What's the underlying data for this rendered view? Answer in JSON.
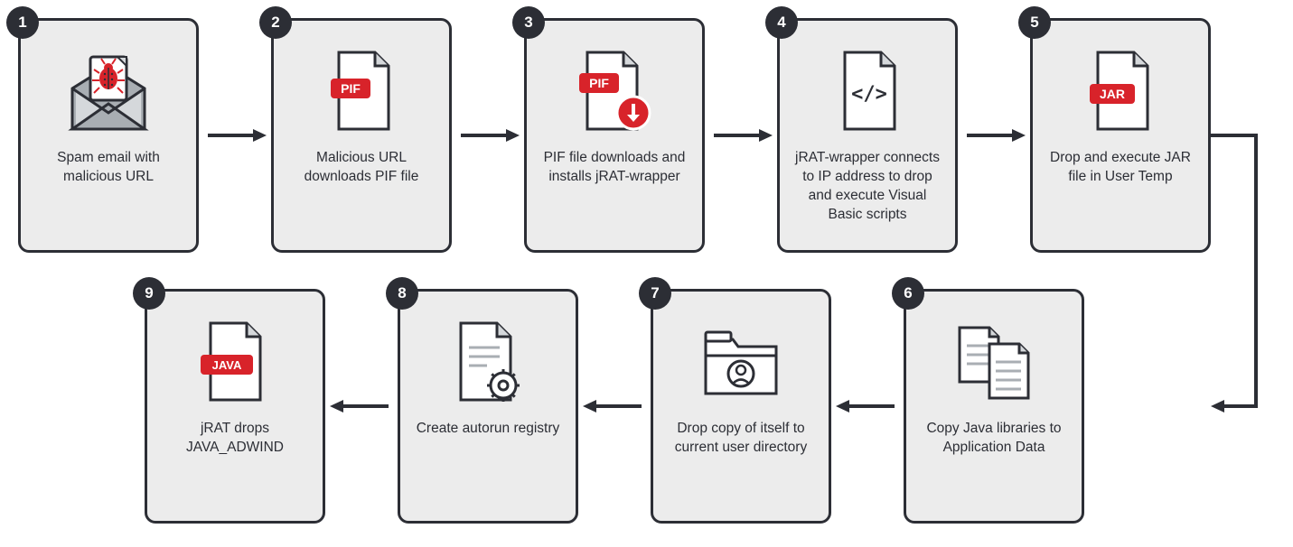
{
  "steps": [
    {
      "num": "1",
      "text": "Spam email with malicious URL",
      "icon": "mail-bug"
    },
    {
      "num": "2",
      "text": "Malicious URL downloads PIF file",
      "icon": "pif-file"
    },
    {
      "num": "3",
      "text": "PIF file downloads and installs jRAT-wrapper",
      "icon": "pif-download"
    },
    {
      "num": "4",
      "text": "jRAT-wrapper connects to IP address to drop and execute Visual Basic scripts",
      "icon": "code-file"
    },
    {
      "num": "5",
      "text": "Drop and execute JAR file in User Temp",
      "icon": "jar-file"
    },
    {
      "num": "6",
      "text": "Copy Java libraries to Application Data",
      "icon": "copy-files"
    },
    {
      "num": "7",
      "text": "Drop copy of itself to current user directory",
      "icon": "user-folder"
    },
    {
      "num": "8",
      "text": "Create autorun registry",
      "icon": "gear-file"
    },
    {
      "num": "9",
      "text": "jRAT drops JAVA_ADWIND",
      "icon": "java-file"
    }
  ],
  "colors": {
    "accent": "#d8232a",
    "dark": "#2c2e35",
    "light": "#ececec",
    "gray": "#a9aeb3"
  }
}
